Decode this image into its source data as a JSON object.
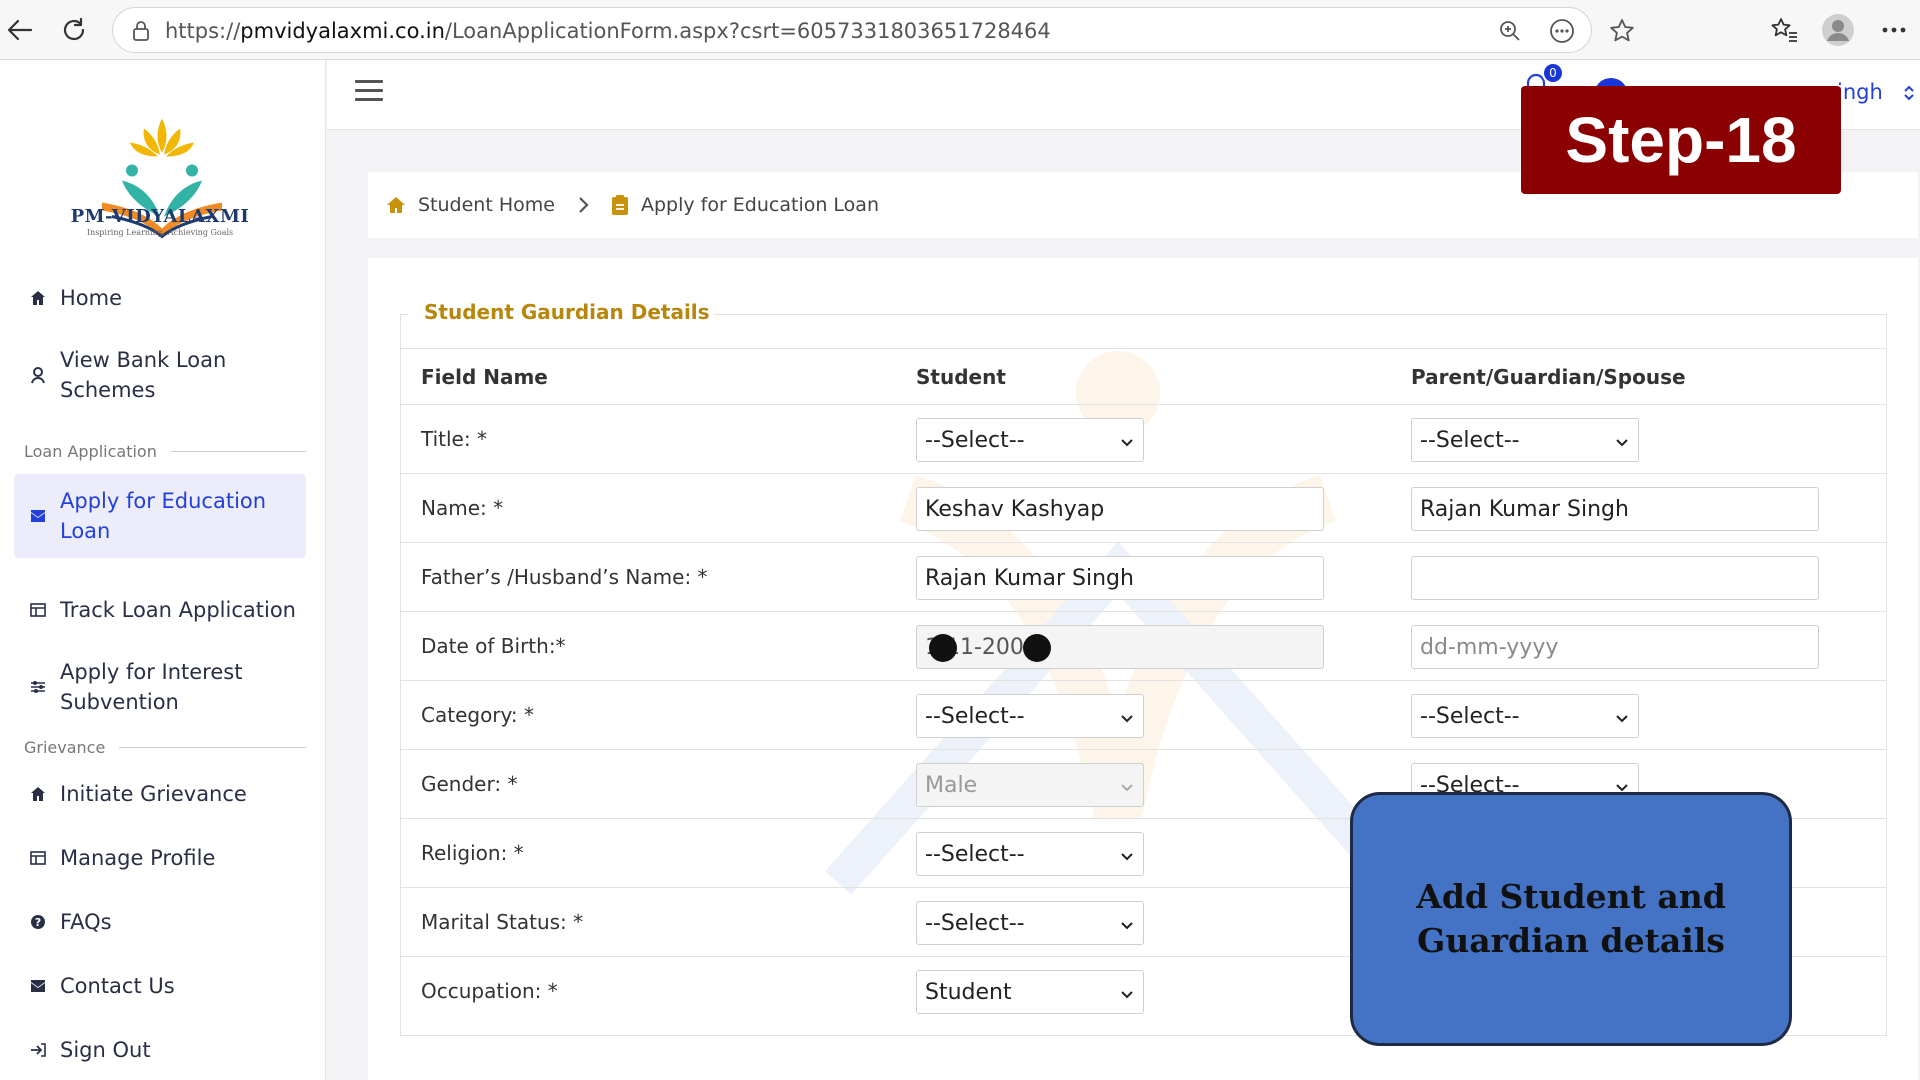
{
  "browser": {
    "url_prefix": "https://",
    "url_host": "pmvidyalaxmi.co.in",
    "url_path": "/LoanApplicationForm.aspx?csrt=6057331803651728464"
  },
  "brand": {
    "name": "PM-VIDYALAXMI",
    "tagline": "Inspiring Learning, Achieving Goals"
  },
  "sidebar": {
    "items_top": [
      {
        "label": "Home",
        "icon": "home-icon"
      },
      {
        "label": "View Bank Loan Schemes",
        "icon": "bank-icon"
      }
    ],
    "section_loan": "Loan Application",
    "items_loan": [
      {
        "label": "Apply for Education Loan",
        "icon": "mail-icon",
        "active": true
      },
      {
        "label": "Track Loan Application",
        "icon": "table-icon"
      },
      {
        "label": "Apply for Interest Subvention",
        "icon": "sliders-icon"
      }
    ],
    "section_grievance": "Grievance",
    "items_grievance": [
      {
        "label": "Initiate Grievance",
        "icon": "home-icon"
      },
      {
        "label": "Manage Profile",
        "icon": "table-icon"
      },
      {
        "label": "FAQs",
        "icon": "question-icon"
      },
      {
        "label": "Contact Us",
        "icon": "mail-icon"
      },
      {
        "label": "Sign Out",
        "icon": "sign-out-icon"
      }
    ]
  },
  "header": {
    "notification_count": "0",
    "user_name_visible": "ingh"
  },
  "step_banner": "Step-18",
  "breadcrumb": {
    "home": "Student Home",
    "current": "Apply for Education Loan"
  },
  "form": {
    "legend": "Student Gaurdian Details",
    "columns": [
      "Field Name",
      "Student",
      "Parent/Guardian/Spouse"
    ],
    "rows": {
      "title": {
        "label": "Title: *",
        "student": "--Select--",
        "guardian": "--Select--"
      },
      "name": {
        "label": "Name: *",
        "student": "Keshav Kashyap",
        "guardian": "Rajan Kumar Singh"
      },
      "father": {
        "label": "Father’s /Husband’s Name: *",
        "student": "Rajan Kumar Singh",
        "guardian": ""
      },
      "dob": {
        "label": "Date of Birth:*",
        "student": "1 11-200",
        "guardian_placeholder": "dd-mm-yyyy"
      },
      "category": {
        "label": "Category: *",
        "student": "--Select--",
        "guardian": "--Select--"
      },
      "gender": {
        "label": "Gender: *",
        "student": "Male",
        "guardian": "--Select--"
      },
      "religion": {
        "label": "Religion: *",
        "student": "--Select--"
      },
      "marital": {
        "label": "Marital Status: *",
        "student": "--Select--"
      },
      "occupation": {
        "label": "Occupation: *",
        "student": "Student"
      }
    }
  },
  "callout": "Add Student and Guardian details",
  "colors": {
    "accent": "#2340d8",
    "legend": "#b8860b",
    "banner": "#8b0000",
    "callout": "#4472c4"
  }
}
